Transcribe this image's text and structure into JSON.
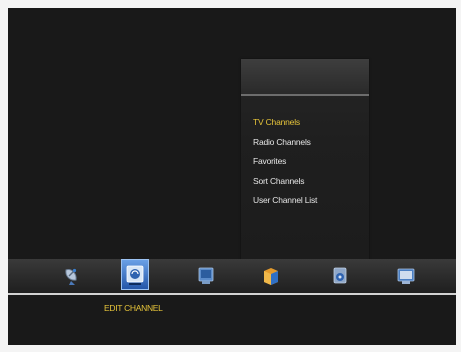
{
  "submenu": {
    "items": [
      {
        "label": "TV Channels",
        "active": true
      },
      {
        "label": "Radio Channels",
        "active": false
      },
      {
        "label": "Favorites",
        "active": false
      },
      {
        "label": "Sort Channels",
        "active": false
      },
      {
        "label": "User Channel List",
        "active": false
      }
    ]
  },
  "iconbar": {
    "selected_label": "EDIT CHANNEL",
    "icons": [
      {
        "name": "satellite-dish-icon",
        "selected": false
      },
      {
        "name": "edit-channel-icon",
        "selected": true
      },
      {
        "name": "monitor-settings-icon",
        "selected": false
      },
      {
        "name": "folder-box-icon",
        "selected": false
      },
      {
        "name": "gear-drive-icon",
        "selected": false
      },
      {
        "name": "media-monitor-icon",
        "selected": false
      }
    ]
  },
  "colors": {
    "highlight_text": "#e7c53a",
    "normal_text": "#e6e6e6",
    "selected_icon_bg": "#3d7bd4"
  }
}
